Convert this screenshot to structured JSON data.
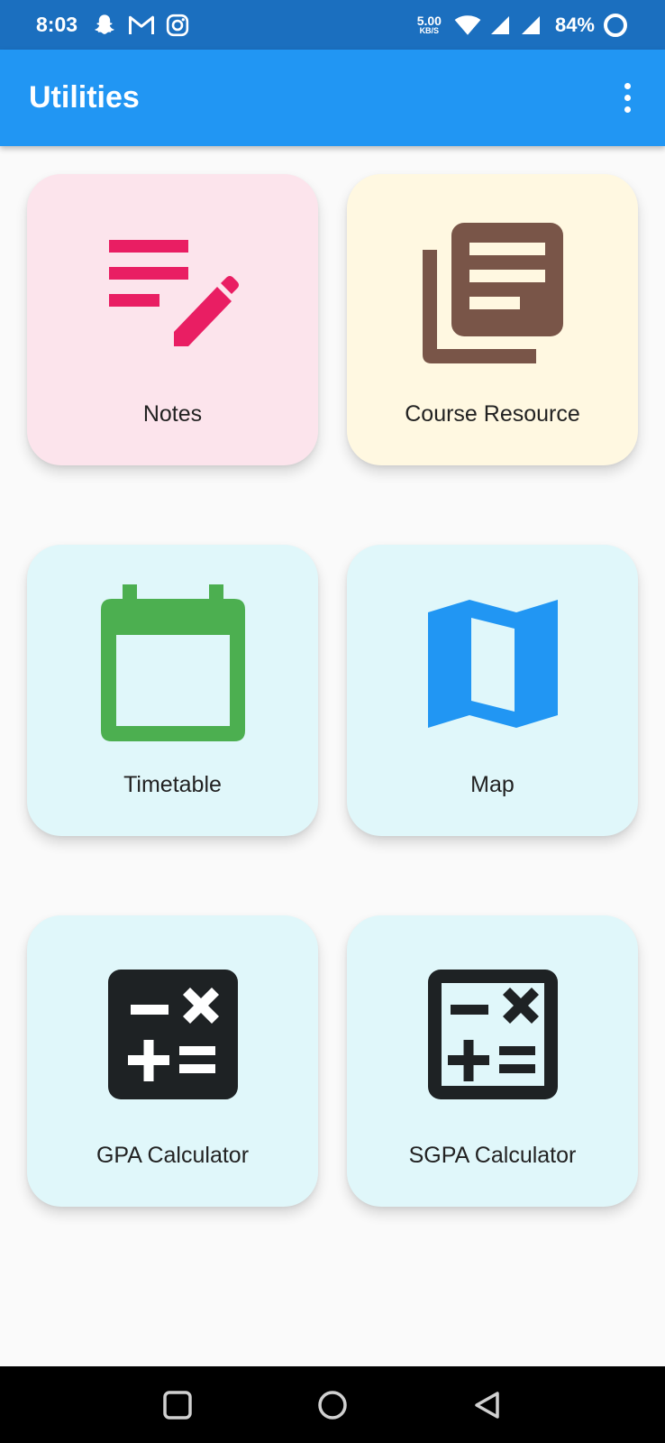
{
  "status_bar": {
    "time": "8:03",
    "net_speed_value": "5.00",
    "net_speed_unit": "KB/S",
    "battery": "84%",
    "icons": [
      "snapchat-icon",
      "gmail-icon",
      "instagram-icon",
      "wifi-icon",
      "signal-icon",
      "signal-icon",
      "battery-ring-icon"
    ]
  },
  "app_bar": {
    "title": "Utilities",
    "background": "#2196f3"
  },
  "cards": [
    {
      "label": "Notes",
      "icon": "notes-edit-icon",
      "background": "#fce4ec",
      "icon_color": "#e91e63"
    },
    {
      "label": "Course Resource",
      "icon": "library-books-icon",
      "background": "#fff8e1",
      "icon_color": "#795548"
    },
    {
      "label": "Timetable",
      "icon": "calendar-icon",
      "background": "#e0f7fa",
      "icon_color": "#4caf50"
    },
    {
      "label": "Map",
      "icon": "map-icon",
      "background": "#e0f7fa",
      "icon_color": "#2196f3"
    },
    {
      "label": "GPA Calculator",
      "icon": "calculator-icon",
      "background": "#e0f7fa",
      "icon_color": "#1e2224"
    },
    {
      "label": "SGPA Calculator",
      "icon": "calculator-outline-icon",
      "background": "#e0f7fa",
      "icon_color": "#1e2224"
    }
  ],
  "nav_bar": {
    "buttons": [
      "recents-icon",
      "home-icon",
      "back-icon"
    ]
  }
}
